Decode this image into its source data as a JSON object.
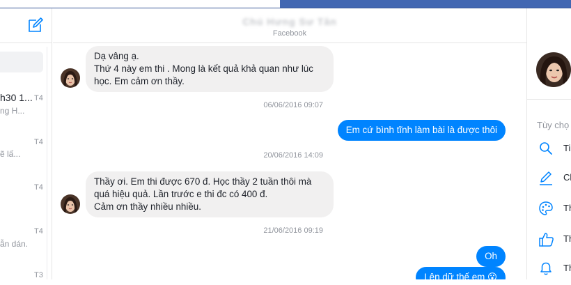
{
  "header": {
    "chat_title": "Chú Hưng Sư Tân",
    "chat_subtitle": "Facebook"
  },
  "conversations": [
    {
      "name": "h30 1...",
      "snippet": "ng H...",
      "time": "T4"
    },
    {
      "name": "",
      "snippet": "ẽ lấ...",
      "time": "T4"
    },
    {
      "name": "",
      "snippet": "",
      "time": "T4"
    },
    {
      "name": "",
      "snippet": "ẫn dán.",
      "time": "T4"
    },
    {
      "name": "",
      "snippet": "",
      "time": "T3"
    }
  ],
  "messages": {
    "m1": {
      "lines": [
        "Dạ vâng ạ.",
        "Thứ 4 này em thi . Mong là kết quả khả quan như lúc",
        "học. Em cảm ơn thầy."
      ]
    },
    "t1": "06/06/2016 09:07",
    "m2": "Em cứ bình tĩnh làm bài là được thôi",
    "t2": "20/06/2016 14:09",
    "m3": {
      "lines": [
        "Thầy ơi. Em thi được 670 đ. Học thầy 2 tuần thôi mà",
        "quá hiệu quả. Lần trước e thi đc có 400 đ.",
        "Cảm ơn thầy nhiều nhiều."
      ]
    },
    "t3": "21/06/2016 09:19",
    "m4": "Oh",
    "m5": "Lên dữ thế em 😮"
  },
  "right_panel": {
    "options_label": "Tùy chọ",
    "items": [
      {
        "icon": "search-icon",
        "label": "Ti"
      },
      {
        "icon": "pencil-icon",
        "label": "Ch"
      },
      {
        "icon": "palette-icon",
        "label": "Th"
      },
      {
        "icon": "thumbs-up-icon",
        "label": "Th"
      },
      {
        "icon": "bell-icon",
        "label": "Th"
      }
    ]
  },
  "colors": {
    "accent": "#0084ff",
    "incoming": "#f1f0f0",
    "brand": "#4267b2"
  }
}
